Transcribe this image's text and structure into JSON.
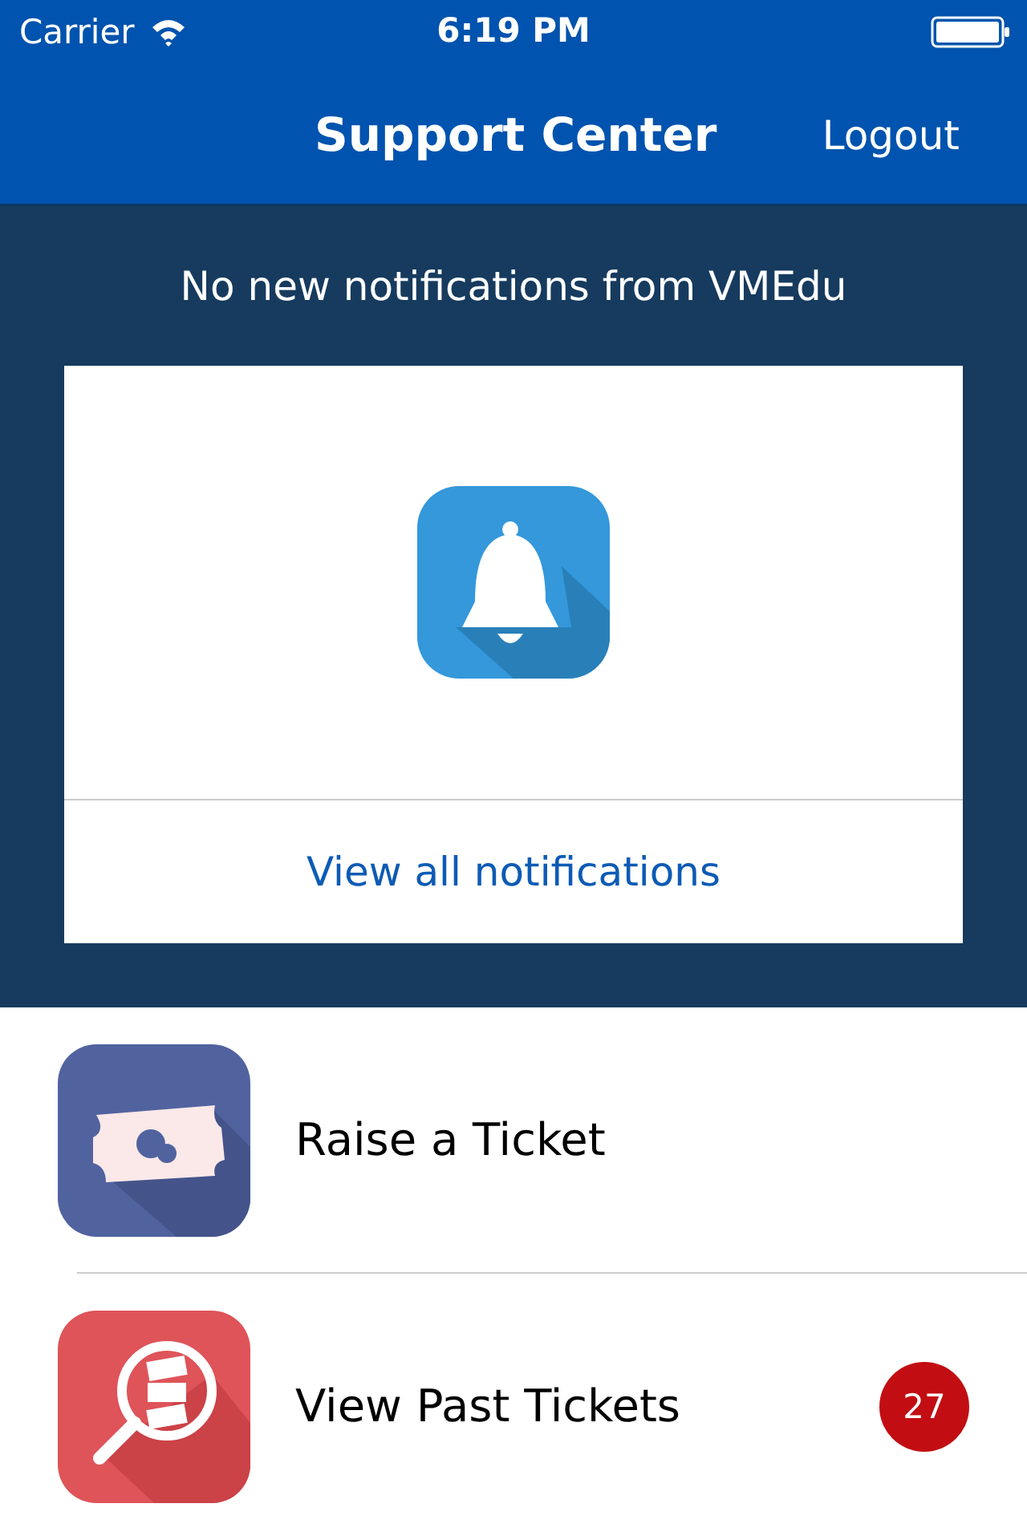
{
  "status_bar": {
    "carrier": "Carrier",
    "time": "6:19 PM"
  },
  "nav": {
    "title": "Support Center",
    "action": "Logout"
  },
  "notifications": {
    "message": "No new notifications from VMEdu",
    "link": "View all notifications"
  },
  "menu": [
    {
      "label": "Raise a Ticket"
    },
    {
      "label": "View Past Tickets",
      "badge": "27"
    }
  ]
}
